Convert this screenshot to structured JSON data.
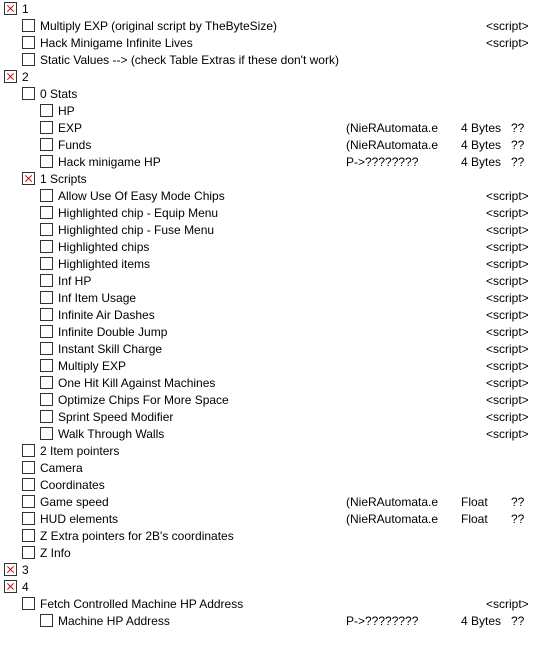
{
  "rows": [
    {
      "indent": 0,
      "checked": true,
      "desc": "1",
      "addr": "",
      "type": "",
      "val": ""
    },
    {
      "indent": 1,
      "checked": false,
      "desc": "Multiply EXP (original script by TheByteSize)",
      "script": "<script>"
    },
    {
      "indent": 1,
      "checked": false,
      "desc": "Hack Minigame Infinite Lives",
      "script": "<script>"
    },
    {
      "indent": 1,
      "checked": false,
      "desc": "Static Values -->  (check Table Extras if these don't work)",
      "addr": "",
      "type": "",
      "val": ""
    },
    {
      "indent": 0,
      "checked": true,
      "desc": "2",
      "addr": "",
      "type": "",
      "val": ""
    },
    {
      "indent": 1,
      "checked": false,
      "desc": "0 Stats",
      "addr": "",
      "type": "",
      "val": ""
    },
    {
      "indent": 2,
      "checked": false,
      "desc": "HP",
      "addr": "",
      "type": "",
      "val": ""
    },
    {
      "indent": 2,
      "checked": false,
      "desc": "EXP",
      "addr": "(NieRAutomata.e",
      "type": "4 Bytes",
      "val": "??"
    },
    {
      "indent": 2,
      "checked": false,
      "desc": "Funds",
      "addr": "(NieRAutomata.e",
      "type": "4 Bytes",
      "val": "??"
    },
    {
      "indent": 2,
      "checked": false,
      "desc": "Hack minigame HP",
      "addr": "P->????????",
      "type": "4 Bytes",
      "val": "??"
    },
    {
      "indent": 1,
      "checked": true,
      "desc": "1 Scripts",
      "addr": "",
      "type": "",
      "val": ""
    },
    {
      "indent": 2,
      "checked": false,
      "desc": "Allow Use Of Easy Mode Chips",
      "script": "<script>"
    },
    {
      "indent": 2,
      "checked": false,
      "desc": "Highlighted chip - Equip Menu",
      "script": "<script>"
    },
    {
      "indent": 2,
      "checked": false,
      "desc": "Highlighted chip - Fuse Menu",
      "script": "<script>"
    },
    {
      "indent": 2,
      "checked": false,
      "desc": "Highlighted chips",
      "script": "<script>"
    },
    {
      "indent": 2,
      "checked": false,
      "desc": "Highlighted items",
      "script": "<script>"
    },
    {
      "indent": 2,
      "checked": false,
      "desc": "Inf HP",
      "script": "<script>"
    },
    {
      "indent": 2,
      "checked": false,
      "desc": "Inf Item Usage",
      "script": "<script>"
    },
    {
      "indent": 2,
      "checked": false,
      "desc": "Infinite Air Dashes",
      "script": "<script>"
    },
    {
      "indent": 2,
      "checked": false,
      "desc": "Infinite Double Jump",
      "script": "<script>"
    },
    {
      "indent": 2,
      "checked": false,
      "desc": "Instant Skill Charge",
      "script": "<script>"
    },
    {
      "indent": 2,
      "checked": false,
      "desc": "Multiply EXP",
      "script": "<script>"
    },
    {
      "indent": 2,
      "checked": false,
      "desc": "One Hit Kill Against Machines",
      "script": "<script>"
    },
    {
      "indent": 2,
      "checked": false,
      "desc": "Optimize Chips For More Space",
      "script": "<script>"
    },
    {
      "indent": 2,
      "checked": false,
      "desc": "Sprint Speed Modifier",
      "script": "<script>"
    },
    {
      "indent": 2,
      "checked": false,
      "desc": "Walk Through Walls",
      "script": "<script>"
    },
    {
      "indent": 1,
      "checked": false,
      "desc": "2 Item pointers",
      "addr": "",
      "type": "",
      "val": ""
    },
    {
      "indent": 1,
      "checked": false,
      "desc": "Camera",
      "addr": "",
      "type": "",
      "val": ""
    },
    {
      "indent": 1,
      "checked": false,
      "desc": "Coordinates",
      "addr": "",
      "type": "",
      "val": ""
    },
    {
      "indent": 1,
      "checked": false,
      "desc": "Game speed",
      "addr": "(NieRAutomata.e",
      "type": "Float",
      "val": "??"
    },
    {
      "indent": 1,
      "checked": false,
      "desc": "HUD elements",
      "addr": "(NieRAutomata.e",
      "type": "Float",
      "val": "??"
    },
    {
      "indent": 1,
      "checked": false,
      "desc": "Z Extra pointers for 2B's coordinates",
      "addr": "",
      "type": "",
      "val": ""
    },
    {
      "indent": 1,
      "checked": false,
      "desc": "Z Info",
      "addr": "",
      "type": "",
      "val": ""
    },
    {
      "indent": 0,
      "checked": true,
      "desc": "3",
      "addr": "",
      "type": "",
      "val": ""
    },
    {
      "indent": 0,
      "checked": true,
      "desc": "4",
      "addr": "",
      "type": "",
      "val": ""
    },
    {
      "indent": 1,
      "checked": false,
      "desc": "Fetch Controlled Machine HP Address",
      "script": "<script>"
    },
    {
      "indent": 2,
      "checked": false,
      "desc": "Machine HP Address",
      "addr": "P->????????",
      "type": "4 Bytes",
      "val": "??"
    }
  ]
}
